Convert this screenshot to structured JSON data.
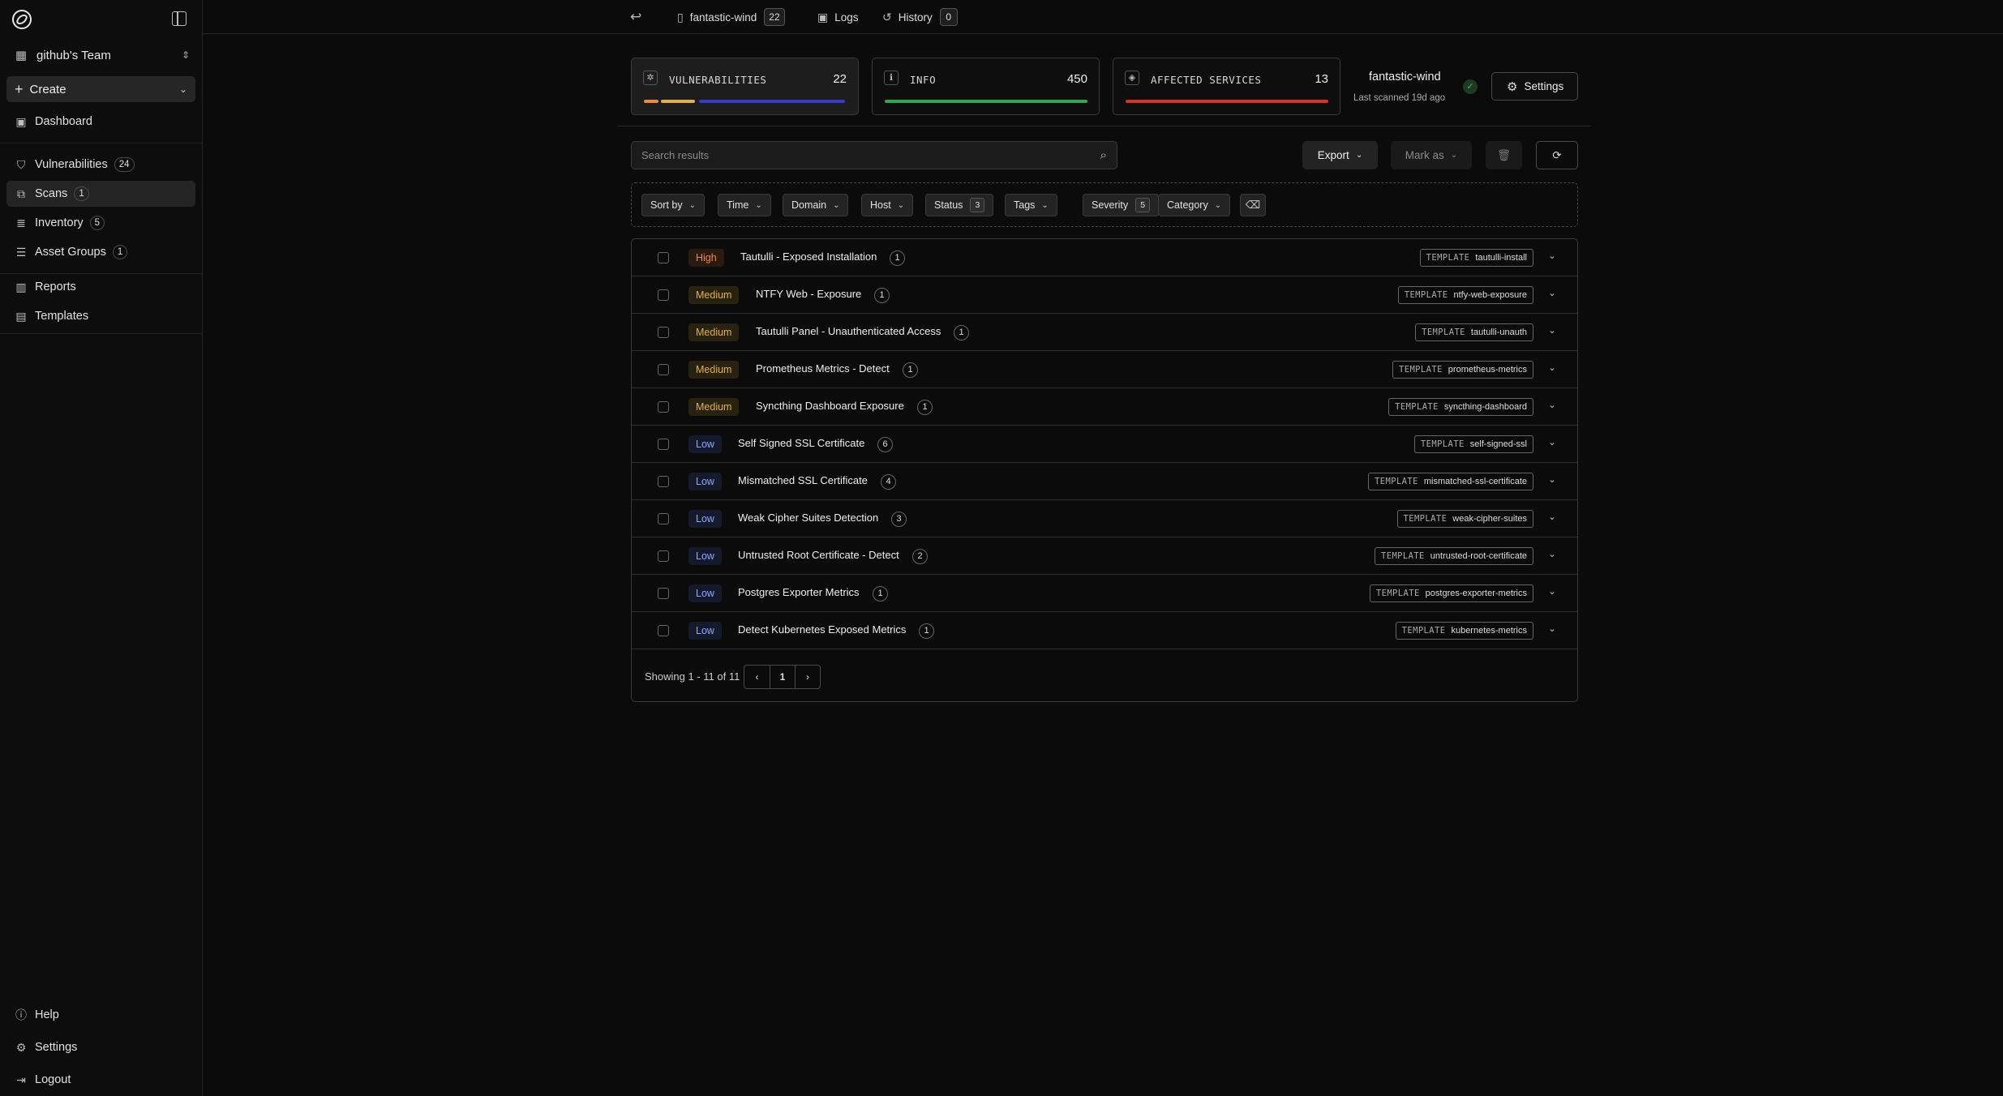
{
  "sidebar": {
    "team_name": "github's Team",
    "create_label": "Create",
    "items": [
      {
        "label": "Dashboard",
        "icon": "dashboard-icon"
      },
      {
        "label": "Vulnerabilities",
        "count": "24",
        "icon": "shield-icon"
      },
      {
        "label": "Scans",
        "count": "1",
        "icon": "scan-icon"
      },
      {
        "label": "Inventory",
        "count": "5",
        "icon": "database-icon"
      },
      {
        "label": "Asset Groups",
        "count": "1",
        "icon": "server-icon"
      },
      {
        "label": "Reports",
        "icon": "chart-icon"
      },
      {
        "label": "Templates",
        "icon": "document-icon"
      }
    ],
    "bottom": [
      {
        "label": "Help",
        "icon": "help-icon"
      },
      {
        "label": "Settings",
        "icon": "gear-icon"
      },
      {
        "label": "Logout",
        "icon": "logout-icon"
      }
    ]
  },
  "topbar": {
    "scan_tab": "fantastic-wind",
    "scan_count": "22",
    "logs_tab": "Logs",
    "history_tab": "History",
    "history_count": "0"
  },
  "summary": {
    "vulnerabilities": {
      "label": "VULNERABILITIES",
      "value": "22"
    },
    "info": {
      "label": "INFO",
      "value": "450"
    },
    "affected": {
      "label": "AFFECTED SERVICES",
      "value": "13"
    },
    "scan_name": "fantastic-wind",
    "last_scanned": "Last scanned 19d ago",
    "settings_label": "Settings"
  },
  "toolbar": {
    "search_placeholder": "Search results",
    "export_label": "Export",
    "mark_as_label": "Mark as"
  },
  "filters": [
    {
      "label": "Sort by"
    },
    {
      "label": "Time"
    },
    {
      "label": "Domain"
    },
    {
      "label": "Host"
    },
    {
      "label": "Status",
      "count": "3"
    },
    {
      "label": "Tags"
    },
    {
      "label": "Severity",
      "count": "5"
    },
    {
      "label": "Category"
    }
  ],
  "results": [
    {
      "severity": "High",
      "title": "Tautulli - Exposed Installation",
      "count": "1",
      "template_key": "TEMPLATE",
      "template": "tautulli-install"
    },
    {
      "severity": "Medium",
      "title": "NTFY Web - Exposure",
      "count": "1",
      "template_key": "TEMPLATE",
      "template": "ntfy-web-exposure"
    },
    {
      "severity": "Medium",
      "title": "Tautulli Panel - Unauthenticated Access",
      "count": "1",
      "template_key": "TEMPLATE",
      "template": "tautulli-unauth"
    },
    {
      "severity": "Medium",
      "title": "Prometheus Metrics - Detect",
      "count": "1",
      "template_key": "TEMPLATE",
      "template": "prometheus-metrics"
    },
    {
      "severity": "Medium",
      "title": "Syncthing Dashboard Exposure",
      "count": "1",
      "template_key": "TEMPLATE",
      "template": "syncthing-dashboard"
    },
    {
      "severity": "Low",
      "title": "Self Signed SSL Certificate",
      "count": "6",
      "template_key": "TEMPLATE",
      "template": "self-signed-ssl"
    },
    {
      "severity": "Low",
      "title": "Mismatched SSL Certificate",
      "count": "4",
      "template_key": "TEMPLATE",
      "template": "mismatched-ssl-certificate"
    },
    {
      "severity": "Low",
      "title": "Weak Cipher Suites Detection",
      "count": "3",
      "template_key": "TEMPLATE",
      "template": "weak-cipher-suites"
    },
    {
      "severity": "Low",
      "title": "Untrusted Root Certificate - Detect",
      "count": "2",
      "template_key": "TEMPLATE",
      "template": "untrusted-root-certificate"
    },
    {
      "severity": "Low",
      "title": "Postgres Exporter Metrics",
      "count": "1",
      "template_key": "TEMPLATE",
      "template": "postgres-exporter-metrics"
    },
    {
      "severity": "Low",
      "title": "Detect Kubernetes Exposed Metrics",
      "count": "1",
      "template_key": "TEMPLATE",
      "template": "kubernetes-metrics"
    }
  ],
  "pagination": {
    "summary": "Showing 1 - 11 of 11",
    "page": "1"
  },
  "colors": {
    "high": "#f08a3c",
    "medium": "#e2b04a",
    "low": "#8ea8ff",
    "info_bar": "#2fa84f",
    "affected_bar": "#d6322a"
  }
}
